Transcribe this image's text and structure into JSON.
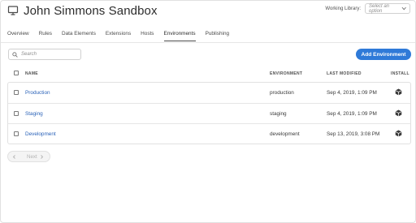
{
  "header": {
    "title": "John Simmons Sandbox",
    "working_library_label": "Working Library:",
    "working_library_placeholder": "Select an option"
  },
  "tabs": [
    {
      "label": "Overview"
    },
    {
      "label": "Rules"
    },
    {
      "label": "Data Elements"
    },
    {
      "label": "Extensions"
    },
    {
      "label": "Hosts"
    },
    {
      "label": "Environments",
      "active": true
    },
    {
      "label": "Publishing"
    }
  ],
  "toolbar": {
    "search_placeholder": "Search",
    "add_button_label": "Add Environment"
  },
  "table": {
    "columns": {
      "name": "NAME",
      "environment": "ENVIRONMENT",
      "last_modified": "LAST MODIFIED",
      "install": "INSTALL"
    },
    "rows": [
      {
        "name": "Production",
        "environment": "production",
        "last_modified": "Sep 4, 2019, 1:09 PM"
      },
      {
        "name": "Staging",
        "environment": "staging",
        "last_modified": "Sep 4, 2019, 1:09 PM"
      },
      {
        "name": "Development",
        "environment": "development",
        "last_modified": "Sep 13, 2019, 3:08 PM"
      }
    ]
  },
  "pagination": {
    "next_label": "Next"
  },
  "colors": {
    "accent": "#2f7ad8",
    "link": "#2a62b8"
  },
  "icons": {
    "header": "monitor-icon",
    "search": "search-icon",
    "select": "chevron-down-icon",
    "install": "install-package-icon",
    "pager_prev": "chevron-left-icon",
    "pager_next": "chevron-right-icon"
  }
}
